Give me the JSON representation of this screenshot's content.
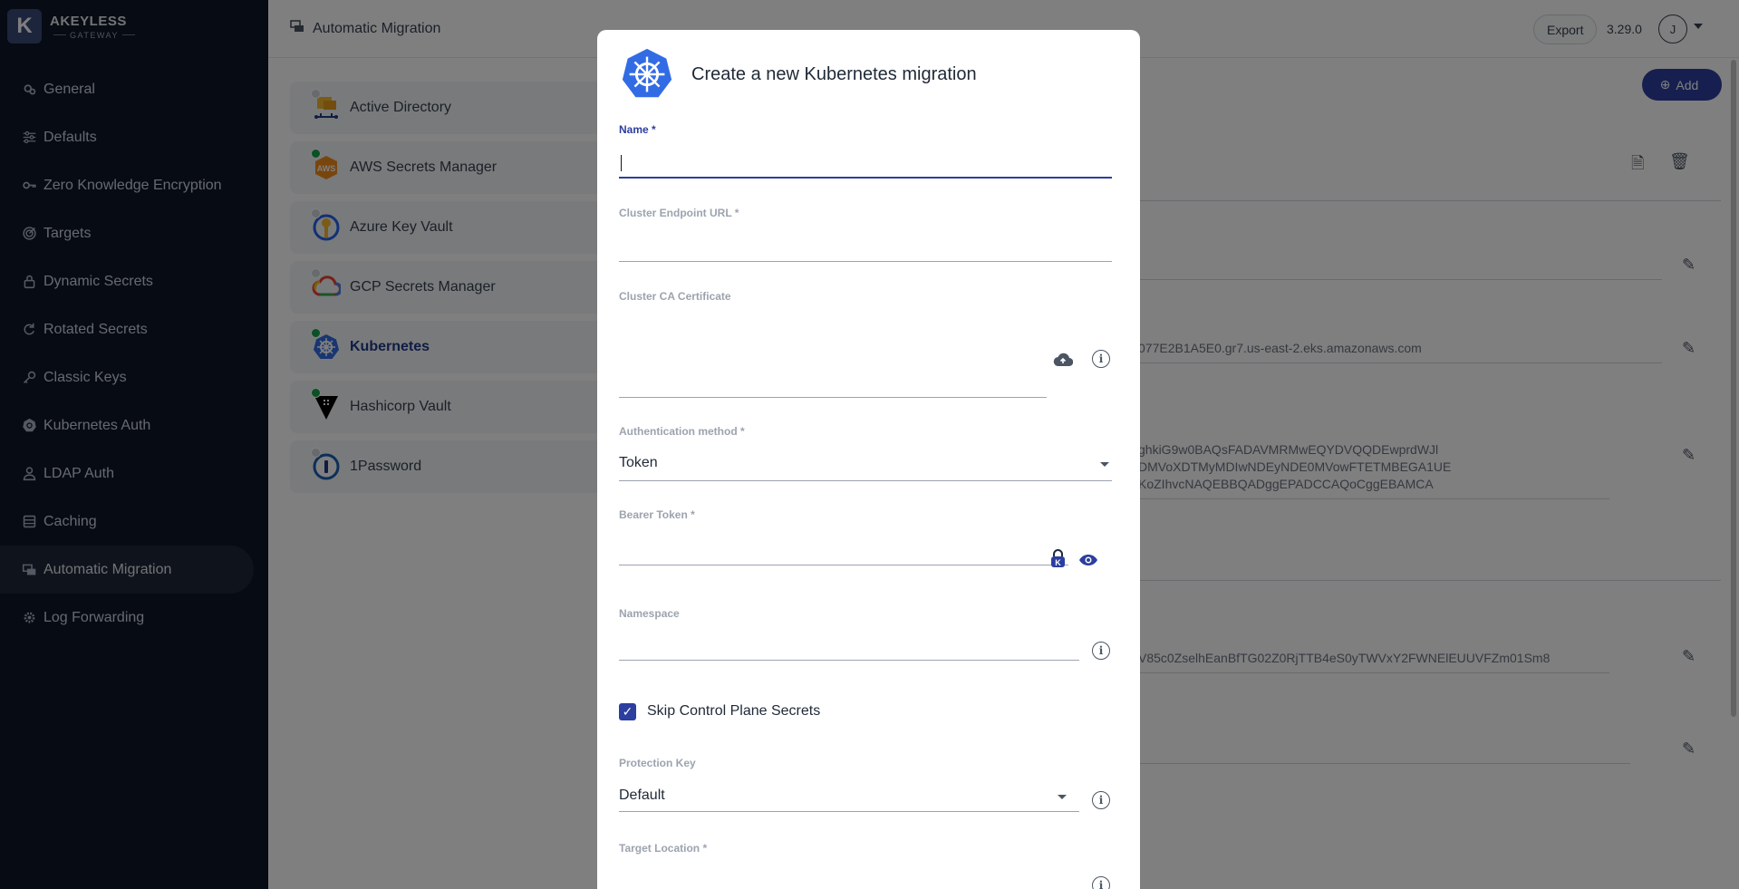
{
  "brand": {
    "logo_letter": "K",
    "name": "AKEYLESS",
    "sub": "GATEWAY"
  },
  "sidebar": {
    "items": [
      {
        "label": "General",
        "icon": "cog-stack-icon"
      },
      {
        "label": "Defaults",
        "icon": "sliders-icon"
      },
      {
        "label": "Zero Knowledge Encryption",
        "icon": "key-icon"
      },
      {
        "label": "Targets",
        "icon": "target-icon"
      },
      {
        "label": "Dynamic Secrets",
        "icon": "lock-icon"
      },
      {
        "label": "Rotated Secrets",
        "icon": "rotate-icon"
      },
      {
        "label": "Classic Keys",
        "icon": "key-icon"
      },
      {
        "label": "Kubernetes Auth",
        "icon": "kubernetes-icon"
      },
      {
        "label": "LDAP Auth",
        "icon": "user-icon"
      },
      {
        "label": "Caching",
        "icon": "database-icon"
      },
      {
        "label": "Automatic Migration",
        "icon": "migration-icon",
        "active": true
      },
      {
        "label": "Log Forwarding",
        "icon": "gear-icon"
      }
    ]
  },
  "header": {
    "title": "Automatic Migration",
    "export_label": "Export",
    "version": "3.29.0",
    "avatar_letter": "J"
  },
  "migrations": {
    "add_label": "Add",
    "items": [
      {
        "label": "Active Directory",
        "status": "grey"
      },
      {
        "label": "AWS Secrets Manager",
        "status": "green"
      },
      {
        "label": "Azure Key Vault",
        "status": "grey"
      },
      {
        "label": "GCP Secrets Manager",
        "status": "grey"
      },
      {
        "label": "Kubernetes",
        "status": "green",
        "active": true
      },
      {
        "label": "Hashicorp Vault",
        "status": "green"
      },
      {
        "label": "1Password",
        "status": "grey"
      }
    ]
  },
  "detail": {
    "endpoint": "077E2B1A5E0.gr7.us-east-2.eks.amazonaws.com",
    "cert_line1": "ghkiG9w0BAQsFADAVMRMwEQYDVQQDEwprdWJl",
    "cert_line2": "DMVoXDTMyMDIwNDEyNDE0MVowFTETMBEGA1UE",
    "cert_line3": "KoZIhvcNAQEBBQADggEPADCCAQoCggEBAMCA",
    "token": "V85c0ZselhEanBfTG02Z0RjTTB4eS0yTWVxY2FWNElEUUVFZm01Sm8"
  },
  "modal": {
    "title": "Create a new Kubernetes migration",
    "name_label": "Name *",
    "endpoint_label": "Cluster Endpoint URL *",
    "ca_label": "Cluster CA Certificate",
    "auth_label": "Authentication method *",
    "auth_value": "Token",
    "bearer_label": "Bearer Token *",
    "namespace_label": "Namespace",
    "skip_label": "Skip Control Plane Secrets",
    "skip_checked": true,
    "protection_label": "Protection Key",
    "protection_value": "Default",
    "target_label": "Target Location *"
  },
  "colors": {
    "sidebar_bg": "#0f1729",
    "accent": "#2c3e9f",
    "status_green": "#16a34a"
  }
}
